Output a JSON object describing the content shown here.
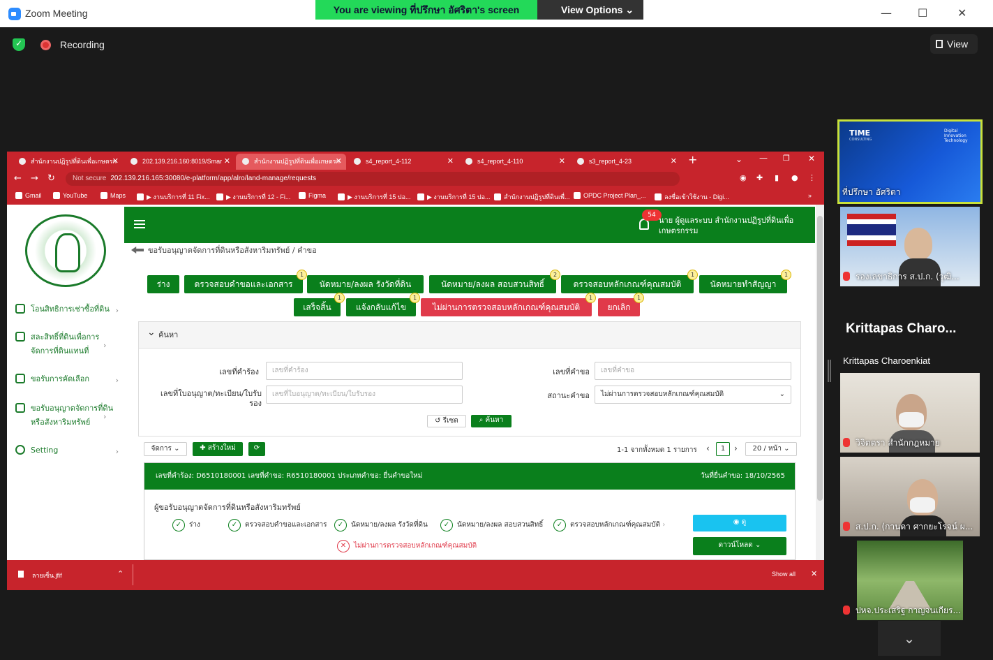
{
  "zoom": {
    "window_title": "Zoom Meeting",
    "viewing_banner": "You are viewing ที่ปรึกษา อัศริตา's screen",
    "view_options": "View Options ⌄",
    "recording": "Recording",
    "view_button": "View",
    "participants": [
      {
        "name": "ที่ปรึกษา อัศริตา"
      },
      {
        "name": "รองเลขาธิการ ส.ป.ก. (วุฒิ..."
      },
      {
        "name": "Krittapas Charoenkiat",
        "big_label": "Krittapas Charo..."
      },
      {
        "name": "วิจิตตรา สำนักกฎหมาย"
      },
      {
        "name": "ส.ป.ก. (กานดา ศากยะโรจน์ ผ..."
      },
      {
        "name": "ปหจ.ประเสริฐ กาญจนเกียร..."
      }
    ],
    "share_tile": {
      "brand": "TIME",
      "brand_sub": "CONSULTING",
      "right_text": "Digital Innovation Technology"
    }
  },
  "browser": {
    "tabs": [
      {
        "label": "สำนักงานปฏิรูปที่ดินเพื่อเกษตรก"
      },
      {
        "label": "202.139.216.160:8019/Smar"
      },
      {
        "label": "สำนักงานปฏิรูปที่ดินเพื่อเกษตรก"
      },
      {
        "label": "s4_report_4-112"
      },
      {
        "label": "s4_report_4-110"
      },
      {
        "label": "s3_report_4-23"
      }
    ],
    "not_secure": "Not secure",
    "url": "202.139.216.165:30080/e-platform/app/alro/land-manage/requests",
    "bookmarks": [
      "Gmail",
      "YouTube",
      "Maps",
      "▶ งานบริการที่ 11 Fix...",
      "▶ งานบริการที่ 12 - Fi...",
      "Figma",
      "▶ งานบริการที่ 15 ปอ...",
      "▶ งานบริการที่ 15 ปอ...",
      "สำนักงานปฏิรูปที่ดินเพื่...",
      "OPDC Project Plan_...",
      "ลงชื่อเข้าใช้งาน - Digi..."
    ],
    "download_file": "ลายเซ็น.jfif",
    "show_all": "Show all"
  },
  "sidebar": {
    "items": [
      {
        "label": "โอนสิทธิการเช่าซื้อที่ดิน"
      },
      {
        "label": "สละสิทธิ์ที่ดินเพื่อการจัดการที่ดินแทนที่"
      },
      {
        "label": "ขอรับการคัดเลือก"
      },
      {
        "label": "ขอรับอนุญาตจัดการที่ดินหรือสังหาริมทรัพย์"
      },
      {
        "label": "Setting"
      }
    ]
  },
  "header": {
    "notifications": "54",
    "user": "นาย ผู้ดูแลระบบ สำนักงานปฏิรูปที่ดินเพื่อเกษตรกรรม"
  },
  "breadcrumb": {
    "parent": "ขอรับอนุญาตจัดการที่ดินหรือสังหาริมทรัพย์",
    "sep": "/",
    "current": "คำขอ"
  },
  "status_buttons": [
    {
      "label": "ร่าง",
      "count": ""
    },
    {
      "label": "ตรวจสอบคำขอและเอกสาร",
      "count": "1"
    },
    {
      "label": "นัดหมาย/ลงผล รังวัดที่ดิน",
      "count": ""
    },
    {
      "label": "นัดหมาย/ลงผล สอบสวนสิทธิ์",
      "count": "2"
    },
    {
      "label": "ตรวจสอบหลักเกณฑ์คุณสมบัติ",
      "count": "1"
    },
    {
      "label": "นัดหมายทำสัญญา",
      "count": "1"
    },
    {
      "label": "เสร็จสิ้น",
      "count": "1"
    },
    {
      "label": "แจ้งกลับแก้ไข",
      "count": "1"
    },
    {
      "label": "ไม่ผ่านการตรวจสอบหลักเกณฑ์คุณสมบัติ",
      "count": "1"
    },
    {
      "label": "ยกเลิก",
      "count": "1"
    }
  ],
  "search": {
    "title": "ค้นหา",
    "request_no_label": "เลขที่คำร้อง",
    "request_no_placeholder": "เลขที่คำร้อง",
    "application_no_label": "เลขที่คำขอ",
    "application_no_placeholder": "เลขที่คำขอ",
    "license_label": "เลขที่ใบอนุญาต/ทะเบียน/ใบรับรอง",
    "license_placeholder": "เลขที่ใบอนุญาต/ทะเบียน/ใบรับรอง",
    "status_label": "สถานะคำขอ",
    "status_value": "ไม่ผ่านการตรวจสอบหลักเกณฑ์คุณสมบัติ",
    "reset": "รีเซต",
    "submit": "ค้นหา"
  },
  "list_toolbar": {
    "manage": "จัดการ",
    "create": "สร้างใหม่",
    "summary": "1-1 จากทั้งหมด 1 รายการ",
    "page": "1",
    "page_size": "20 / หน้า"
  },
  "record": {
    "header": "เลขที่คำร้อง: D6510180001  เลขที่คำขอ: R6510180001  ประเภทคำขอ: ยื่นคำขอใหม่",
    "date": "วันที่ยื่นคำขอ: 18/10/2565",
    "type": "ผู้ขอรับอนุญาตจัดการที่ดินหรือสังหาริมทรัพย์",
    "steps": [
      "ร่าง",
      "ตรวจสอบคำขอและเอกสาร",
      "นัดหมาย/ลงผล รังวัดที่ดิน",
      "นัดหมาย/ลงผล สอบสวนสิทธิ์",
      "ตรวจสอบหลักเกณฑ์คุณสมบัติ"
    ],
    "failed_step": "ไม่ผ่านการตรวจสอบหลักเกณฑ์คุณสมบัติ",
    "view": "ดู",
    "download": "ดาวน์โหลด"
  }
}
